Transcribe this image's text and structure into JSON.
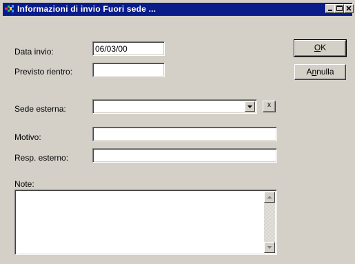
{
  "window": {
    "title": "Informazioni di invio Fuori sede ...",
    "title_bar_color": "#0a1b8a",
    "icons": [
      "app-icon",
      "minimize-icon",
      "maximize-icon",
      "close-icon"
    ]
  },
  "form": {
    "data_invio": {
      "label": "Data invio:",
      "value": "06/03/00"
    },
    "previsto_rientro": {
      "label": "Previsto rientro:",
      "value": ""
    },
    "sede_esterna": {
      "label": "Sede esterna:",
      "value": "",
      "clear_label": "x"
    },
    "motivo": {
      "label": "Motivo:",
      "value": ""
    },
    "resp_esterno": {
      "label": "Resp. esterno:",
      "value": ""
    },
    "note": {
      "label": "Note:",
      "value": ""
    }
  },
  "buttons": {
    "ok": {
      "prefix": "",
      "accel": "O",
      "rest": "K"
    },
    "annulla": {
      "prefix": "A",
      "accel": "n",
      "rest": "nulla"
    }
  }
}
